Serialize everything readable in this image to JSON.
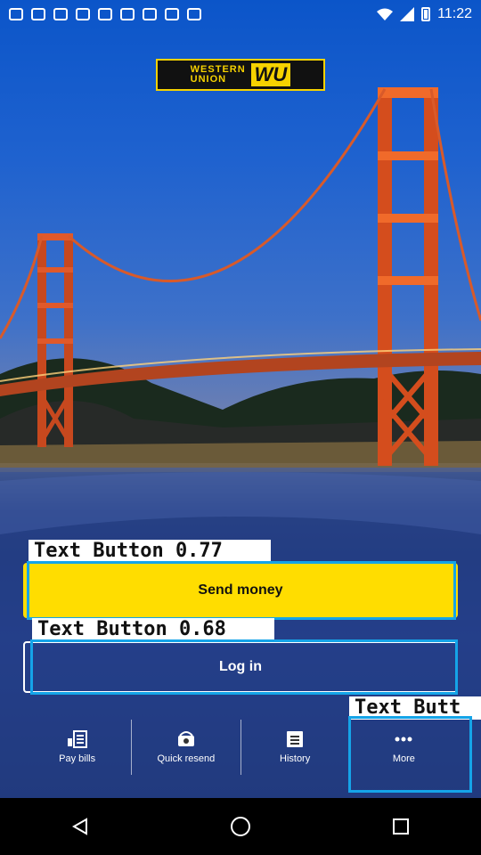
{
  "status_bar": {
    "time": "11:22",
    "notification_icons": [
      "app-icon",
      "app-icon",
      "app-icon",
      "app-icon",
      "app-icon",
      "app-icon",
      "app-icon",
      "app-icon",
      "app-icon"
    ]
  },
  "logo": {
    "line1": "WESTERN",
    "line2": "UNION",
    "mark": "WU"
  },
  "annotations": [
    {
      "label": "Text Button 0.77"
    },
    {
      "label": "Text Button 0.68"
    },
    {
      "label": "Text Butt"
    }
  ],
  "actions": {
    "send_money": "Send money",
    "log_in": "Log in"
  },
  "tabs": [
    {
      "label": "Pay bills",
      "icon": "bills-icon"
    },
    {
      "label": "Quick resend",
      "icon": "resend-icon"
    },
    {
      "label": "History",
      "icon": "history-icon"
    },
    {
      "label": "More",
      "icon": "more-icon"
    }
  ],
  "colors": {
    "accent": "#ffdd00",
    "annotation": "#15a4e8"
  }
}
